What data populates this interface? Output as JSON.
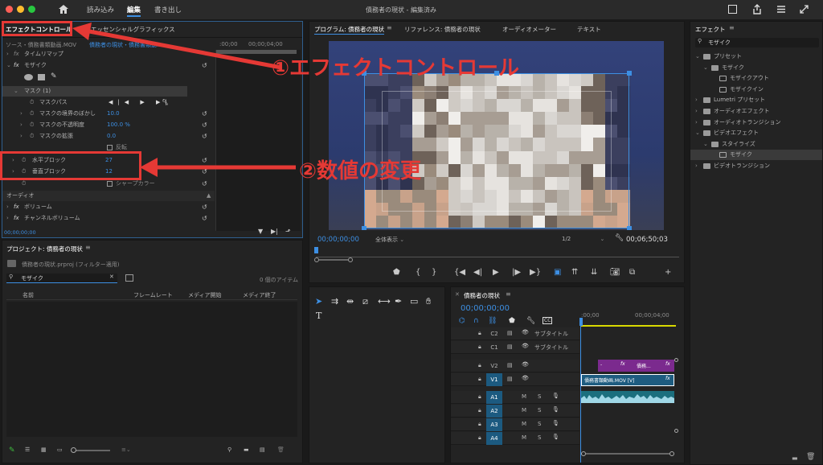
{
  "titlebar": {
    "tabs": [
      "読み込み",
      "編集",
      "書き出し"
    ],
    "active_tab": "編集",
    "doc_title": "債務者の現状 - 編集済み"
  },
  "effect_controls": {
    "tab_label": "エフェクトコントロール",
    "tab2_label": "エッセンシャルグラフィックス",
    "source_label": "ソース・債務書類動画.MOV",
    "seq_label": "債務者の現状・債務書類動...",
    "ruler_t0": ":00;00",
    "ruler_t1": "00;00;04;00",
    "time_remap": "タイムリマップ",
    "mosaic": "モザイク",
    "mask": "マスク (1)",
    "mask_path": "マスクパス",
    "feather_label": "マスクの境界のぼかし",
    "feather_value": "10.0",
    "opacity_label": "マスクの不透明度",
    "opacity_value": "100.0 %",
    "expansion_label": "マスクの拡張",
    "expansion_value": "0.0",
    "inverted_label": "反転",
    "horiz_label": "水平ブロック",
    "horiz_value": "27",
    "vert_label": "垂直ブロック",
    "vert_value": "12",
    "sharp_label": "シャープカラー",
    "audio_label": "オーディオ",
    "volume_label": "ボリューム",
    "channel_label": "チャンネルボリューム",
    "timecode": "00;00;00;00",
    "fx_prefix": "fx"
  },
  "program": {
    "tab_label": "プログラム: 債務者の現状",
    "ref_label": "リファレンス: 債務者の現状",
    "audio_meter": "オーディオメーター",
    "text_label": "テキスト",
    "timecode": "00;00;00;00",
    "fit": "全体表示",
    "resolution": "1/2",
    "duration": "00;06;50;03"
  },
  "project": {
    "title": "プロジェクト: 債務者の現状",
    "file": "債務者の現状.prproj (フィルター適用)",
    "search": "モザイク",
    "count": "0 個のアイテム",
    "cols": [
      "名前",
      "フレームレート",
      "メディア開始",
      "メディア終了"
    ]
  },
  "effects": {
    "title": "エフェクト",
    "search": "モザイク",
    "items": [
      {
        "label": "プリセット",
        "indent": 0,
        "open": true
      },
      {
        "label": "モザイク",
        "indent": 1,
        "open": true
      },
      {
        "label": "モザイクアウト",
        "indent": 2,
        "open": false,
        "leaf": true
      },
      {
        "label": "モザイクイン",
        "indent": 2,
        "open": false,
        "leaf": true
      },
      {
        "label": "Lumetri プリセット",
        "indent": 0,
        "open": false
      },
      {
        "label": "オーディオエフェクト",
        "indent": 0,
        "open": false
      },
      {
        "label": "オーディオトランジション",
        "indent": 0,
        "open": false
      },
      {
        "label": "ビデオエフェクト",
        "indent": 0,
        "open": true
      },
      {
        "label": "スタイライズ",
        "indent": 1,
        "open": true
      },
      {
        "label": "モザイク",
        "indent": 2,
        "open": false,
        "leaf": true,
        "selected": true
      },
      {
        "label": "ビデオトランジション",
        "indent": 0,
        "open": false
      }
    ]
  },
  "timeline": {
    "title": "債務者の現状",
    "timecode": "00;00;00;00",
    "ruler": [
      ":00;00",
      "00;00;04;00"
    ],
    "tracks": [
      {
        "name": "C2",
        "label": "サブタイトル"
      },
      {
        "name": "C1",
        "label": "サブタイトル"
      },
      {
        "name": "V2",
        "label": ""
      },
      {
        "name": "V1",
        "label": ""
      },
      {
        "name": "A1",
        "label": ""
      },
      {
        "name": "A2",
        "label": ""
      },
      {
        "name": "A3",
        "label": ""
      },
      {
        "name": "A4",
        "label": ""
      }
    ],
    "clip_v2": "債務...",
    "clip_v1": "債務書類動画.MOV [V]",
    "mute": "M",
    "solo": "S"
  },
  "annotations": {
    "a1": "①エフェクトコントロール",
    "a2": "②数値の変更"
  },
  "colors": {
    "accent": "#3d8fe3",
    "annotation_red": "#e53935",
    "clip_purple": "#8a2d9a",
    "clip_blue": "#1f6f8f"
  }
}
